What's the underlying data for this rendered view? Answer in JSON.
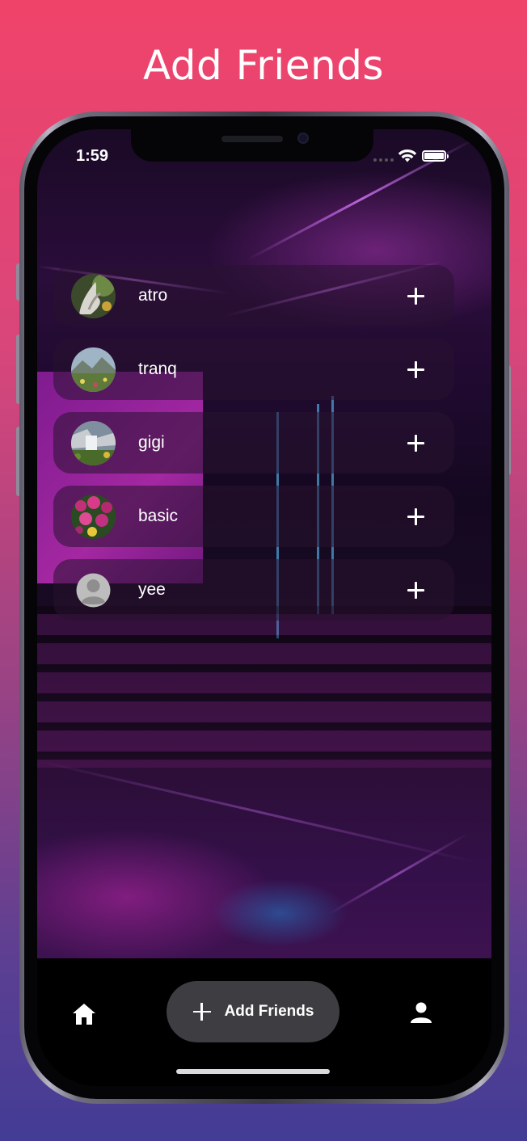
{
  "headline": "Add Friends",
  "status_bar": {
    "time": "1:59"
  },
  "friends": [
    {
      "name": "atro",
      "avatar": "avatar-sculpture"
    },
    {
      "name": "tranq",
      "avatar": "avatar-mountain-meadow"
    },
    {
      "name": "gigi",
      "avatar": "avatar-waterfall"
    },
    {
      "name": "basic",
      "avatar": "avatar-flowers"
    },
    {
      "name": "yee",
      "avatar": "avatar-default-person"
    }
  ],
  "bottom_nav": {
    "home_icon": "home-icon",
    "add_friends_label": "Add Friends",
    "profile_icon": "person-icon"
  },
  "colors": {
    "background_top": "#f0436a",
    "background_bottom": "#433c95",
    "row_background": "rgba(40,18,48,0.55)",
    "button_background": "#3e3e42"
  }
}
